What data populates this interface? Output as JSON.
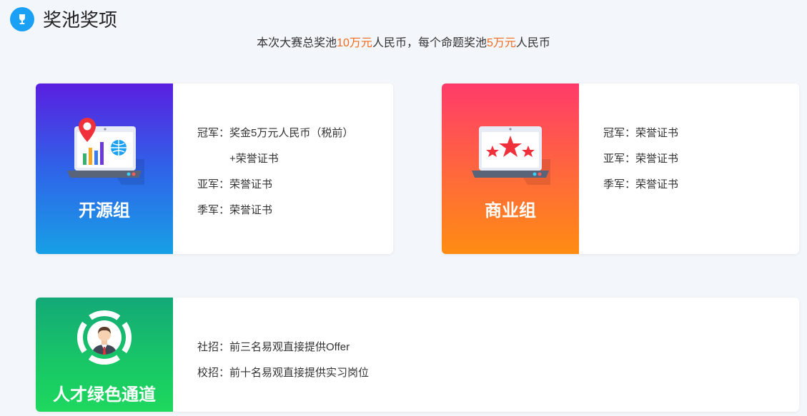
{
  "header": {
    "title": "奖池奖项",
    "icon": "trophy-icon",
    "accent": "#1aa0f5"
  },
  "subtitle": {
    "prefix": "本次大赛总奖池",
    "total": "10万元",
    "middle": "人民币，每个命题奖池",
    "per_topic": "5万元",
    "suffix": "人民币",
    "highlight_color": "#f26b1d"
  },
  "cards": {
    "open_source": {
      "label": "开源组",
      "rows": [
        {
          "key": "冠军：",
          "value": "奖金5万元人民币（税前）"
        },
        {
          "key": "",
          "value": "+荣誉证书"
        },
        {
          "key": "亚军：",
          "value": "荣誉证书"
        },
        {
          "key": "季军：",
          "value": "荣誉证书"
        }
      ]
    },
    "business": {
      "label": "商业组",
      "rows": [
        {
          "key": "冠军：",
          "value": "荣誉证书"
        },
        {
          "key": "亚军：",
          "value": "荣誉证书"
        },
        {
          "key": "季军：",
          "value": "荣誉证书"
        }
      ]
    },
    "talent": {
      "label": "人才绿色通道",
      "rows": [
        {
          "key": "社招：",
          "value": "前三名易观直接提供Offer"
        },
        {
          "key": "校招：",
          "value": "前十名易观直接提供实习岗位"
        }
      ]
    }
  }
}
